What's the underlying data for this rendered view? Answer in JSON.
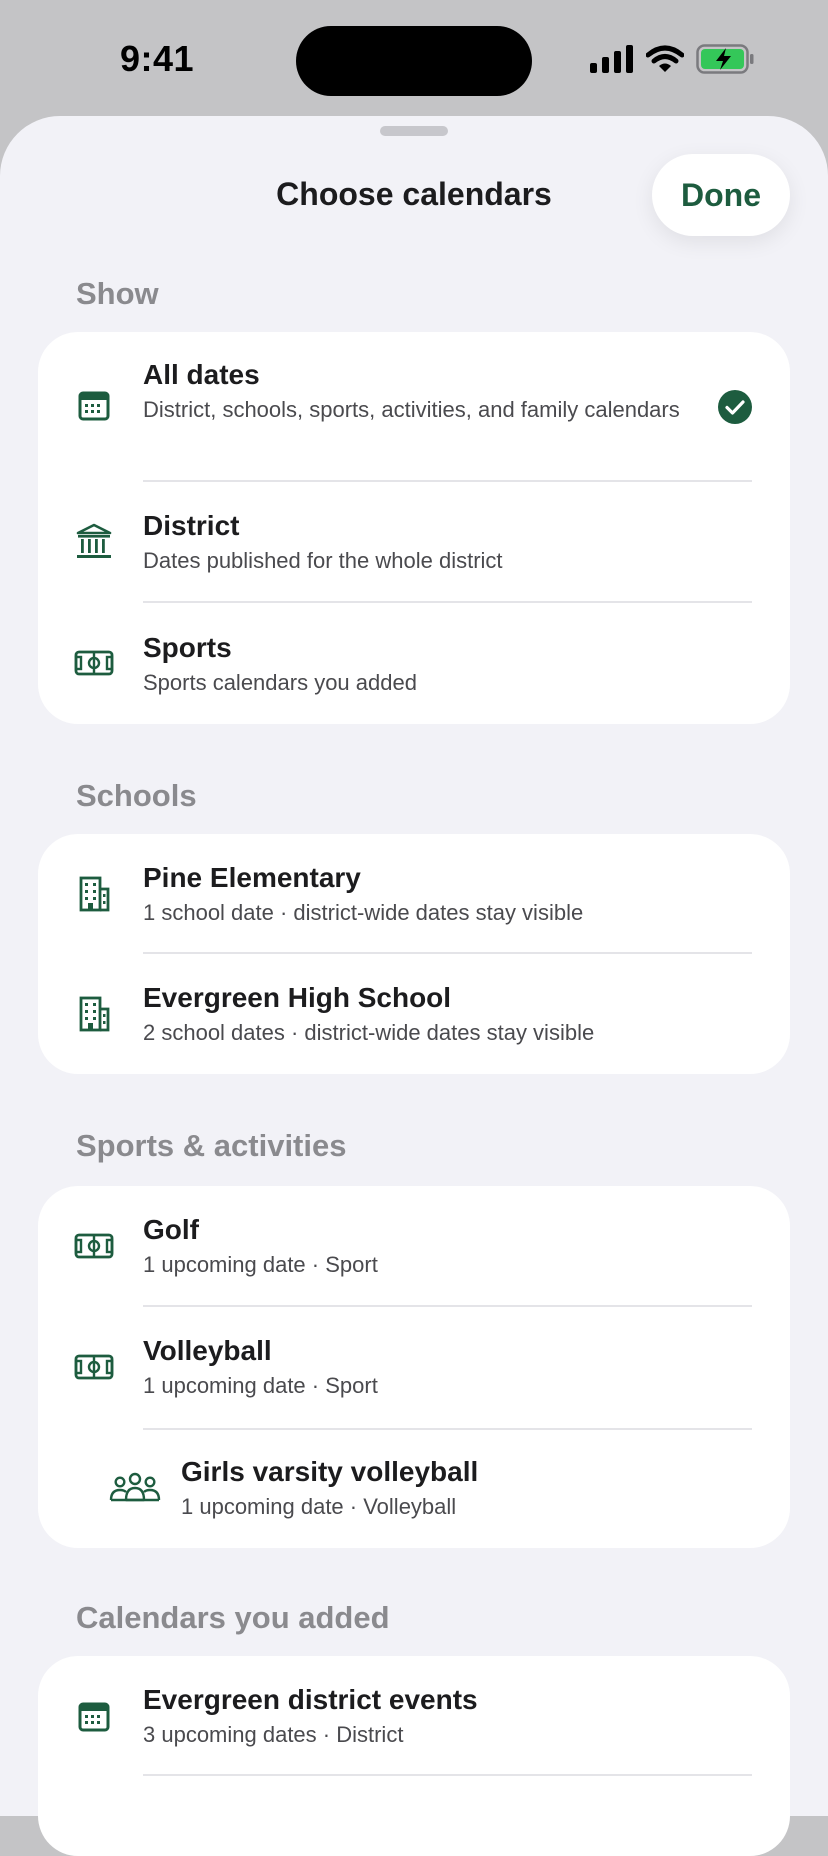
{
  "status_bar": {
    "time": "9:41"
  },
  "sheet": {
    "title": "Choose calendars",
    "done_label": "Done"
  },
  "sections": {
    "show": {
      "header": "Show",
      "items": [
        {
          "label": "All dates",
          "sub": "District, schools, sports, activities, and family calendars",
          "icon": "calendar-icon",
          "selected": true
        },
        {
          "label": "District",
          "sub": "Dates published for the whole district",
          "icon": "bank-icon",
          "selected": false
        },
        {
          "label": "Sports",
          "sub": "Sports calendars you added",
          "icon": "field-icon",
          "selected": false
        }
      ]
    },
    "schools": {
      "header": "Schools",
      "items": [
        {
          "label": "Pine Elementary",
          "sub": "1 school date · district-wide dates stay visible",
          "icon": "building-icon"
        },
        {
          "label": "Evergreen High School",
          "sub": "2 school dates · district-wide dates stay visible",
          "icon": "building-icon"
        }
      ]
    },
    "sports_activities": {
      "header": "Sports & activities",
      "items": [
        {
          "label": "Golf",
          "sub": "1 upcoming date · Sport",
          "icon": "field-icon"
        },
        {
          "label": "Volleyball",
          "sub": "1 upcoming date · Sport",
          "icon": "field-icon"
        },
        {
          "label": "Girls varsity volleyball",
          "sub": "1 upcoming date · Volleyball",
          "icon": "group-icon"
        }
      ]
    },
    "added": {
      "header": "Calendars you added",
      "items": [
        {
          "label": "Evergreen district events",
          "sub": "3 upcoming dates · District",
          "icon": "calendar-icon"
        }
      ]
    }
  },
  "colors": {
    "accent": "#1d5c3f",
    "background": "#f2f2f7",
    "section_header": "#8a8a8e"
  }
}
